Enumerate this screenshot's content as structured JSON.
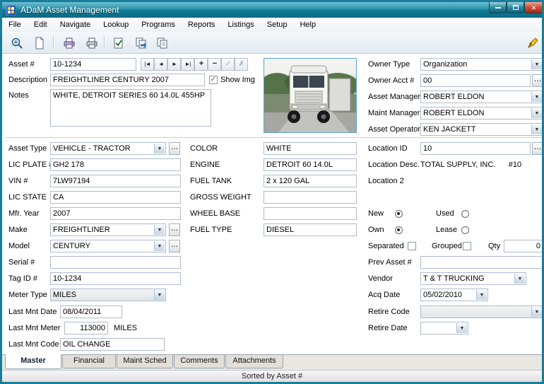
{
  "window": {
    "title": "ADaM Asset Management",
    "status_text": "Sorted by Asset #"
  },
  "menu": {
    "items": [
      "File",
      "Edit",
      "Navigate",
      "Lookup",
      "Programs",
      "Reports",
      "Listings",
      "Setup",
      "Help"
    ]
  },
  "toolbar": {
    "buttons": [
      "zoom",
      "new-record",
      "print-setup",
      "print",
      "post-edit",
      "copy-record",
      "duplicate-record",
      "exit"
    ]
  },
  "icons": {
    "dropdown": "▼",
    "ellipsis": "…",
    "check": "✓",
    "close": "×",
    "nav_first": "|◄",
    "nav_prev": "◄",
    "nav_next": "►",
    "nav_last": "►|",
    "nav_add": "+",
    "nav_del": "−",
    "nav_post": "✓",
    "nav_cancel": "✗"
  },
  "header": {
    "asset_number": {
      "label": "Asset #",
      "value": "10-1234"
    },
    "description": {
      "label": "Description",
      "value": "FREIGHTLINER CENTURY 2007"
    },
    "show_img": {
      "label": "Show Img",
      "checked": true
    },
    "notes": {
      "label": "Notes",
      "value": "WHITE, DETROIT SERIES 60 14.0L 455HP"
    }
  },
  "owner": {
    "owner_type": {
      "label": "Owner Type",
      "value": "Organization"
    },
    "owner_acct": {
      "label": "Owner Acct #",
      "value": "00"
    },
    "asset_manager": {
      "label": "Asset Manager",
      "value": "ROBERT ELDON"
    },
    "maint_manager": {
      "label": "Maint Manager",
      "value": "ROBERT ELDON"
    },
    "asset_operator": {
      "label": "Asset Operator",
      "value": "KEN JACKETT"
    }
  },
  "left": {
    "asset_type": {
      "label": "Asset Type",
      "value": "VEHICLE - TRACTOR"
    },
    "lic_plate": {
      "label": "LIC PLATE #",
      "value": "GH2 178"
    },
    "vin": {
      "label": "VIN #",
      "value": "7LW97194"
    },
    "lic_state": {
      "label": "LIC STATE",
      "value": "CA"
    },
    "mfr_year": {
      "label": "Mfr. Year",
      "value": "2007"
    },
    "make": {
      "label": "Make",
      "value": "FREIGHTLINER"
    },
    "model": {
      "label": "Model",
      "value": "CENTURY"
    },
    "serial": {
      "label": "Serial #",
      "value": ""
    },
    "tag_id": {
      "label": "Tag ID #",
      "value": "10-1234"
    },
    "meter_type": {
      "label": "Meter Type",
      "value": "MILES"
    },
    "last_mnt_date": {
      "label": "Last Mnt Date",
      "value": "08/04/2011"
    },
    "last_mnt_meter": {
      "label": "Last Mnt Meter",
      "value": "113000",
      "unit": "MILES"
    },
    "last_mnt_code": {
      "label": "Last Mnt Code",
      "value": "OIL CHANGE"
    }
  },
  "specs": {
    "color": {
      "label": "COLOR",
      "value": "WHITE"
    },
    "engine": {
      "label": "ENGINE",
      "value": "DETROIT 60 14.0L"
    },
    "fuel_tank": {
      "label": "FUEL TANK",
      "value": "2 x 120 GAL"
    },
    "gross_weight": {
      "label": "GROSS WEIGHT",
      "value": ""
    },
    "wheel_base": {
      "label": "WHEEL BASE",
      "value": ""
    },
    "fuel_type": {
      "label": "FUEL TYPE",
      "value": "DIESEL"
    }
  },
  "loc": {
    "location_id": {
      "label": "Location ID",
      "value": "10"
    },
    "location_desc": {
      "label": "Location Desc.",
      "value": "TOTAL SUPPLY, INC.      #10"
    },
    "location2": {
      "label": "Location 2",
      "value": ""
    },
    "new_label": "New",
    "used_label": "Used",
    "own_label": "Own",
    "lease_label": "Lease",
    "separated_label": "Separated",
    "grouped_label": "Grouped",
    "qty": {
      "label": "Qty",
      "value": "0"
    },
    "prev_asset": {
      "label": "Prev Asset #",
      "value": ""
    },
    "vendor": {
      "label": "Vendor",
      "value": "T & T TRUCKING"
    },
    "acq_date": {
      "label": "Acq Date",
      "value": "05/02/2010"
    },
    "retire_code": {
      "label": "Retire Code",
      "value": ""
    },
    "retire_date": {
      "label": "Retire Date",
      "value": ""
    }
  },
  "tabs": {
    "items": [
      "Master",
      "Financial",
      "Maint Sched",
      "Comments",
      "Attachments"
    ],
    "active": "Master"
  }
}
